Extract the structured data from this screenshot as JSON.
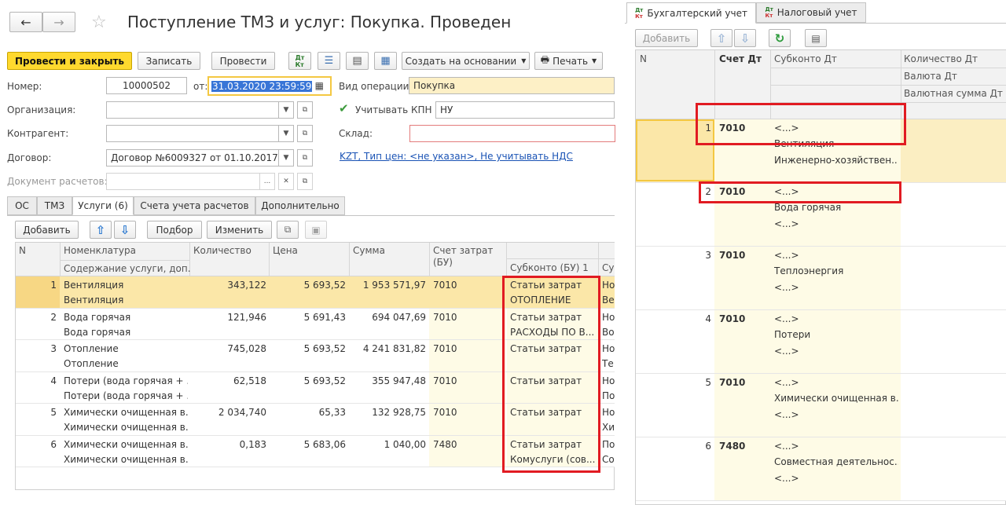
{
  "window": {
    "title": "Поступление ТМЗ и услуг: Покупка. Проведен"
  },
  "toolbar": {
    "post_close": "Провести и закрыть",
    "save": "Записать",
    "post": "Провести",
    "create_based": "Создать на основании",
    "print": "Печать"
  },
  "form": {
    "number_label": "Номер:",
    "number_value": "10000502",
    "date_label": "от:",
    "date_value": "31.03.2020 23:59:59",
    "operation_label": "Вид операции:",
    "operation_value": "Покупка",
    "org_label": "Организация:",
    "kpn_label": "Учитывать КПН",
    "kpn_value": "НУ",
    "counterparty_label": "Контрагент:",
    "warehouse_label": "Склад:",
    "contract_label": "Договор:",
    "contract_value": "Договор №6009327 от 01.10.2017г",
    "price_link": "KZT, Тип цен: <не указан>, Не учитывать НДС",
    "settlement_doc_label": "Документ расчетов:",
    "settlement_doc_dots": "..."
  },
  "tabs": [
    "ОС",
    "ТМЗ",
    "Услуги (6)",
    "Счета учета расчетов",
    "Дополнительно"
  ],
  "table_toolbar": {
    "add": "Добавить",
    "selection": "Подбор",
    "change": "Изменить"
  },
  "services_table": {
    "headers": {
      "n": "N",
      "nomenclature": "Номенклатура",
      "content": "Содержание услуги, доп.",
      "qty": "Количество",
      "price": "Цена",
      "sum": "Сумма",
      "account": "Счет затрат",
      "account2": "(БУ)",
      "subconto": "Субконто (БУ) 1",
      "next": "Су"
    },
    "rows": [
      {
        "n": "1",
        "name": "Вентиляция",
        "content": "Вентиляция",
        "qty": "343,122",
        "price": "5 693,52",
        "sum": "1 953 571,97",
        "account": "7010",
        "sub1": "Статьи затрат",
        "sub2": "ОТОПЛЕНИЕ",
        "c1": "Но",
        "c2": "Ве"
      },
      {
        "n": "2",
        "name": "Вода горячая",
        "content": "Вода горячая",
        "qty": "121,946",
        "price": "5 691,43",
        "sum": "694 047,69",
        "account": "7010",
        "sub1": "Статьи затрат",
        "sub2": "РАСХОДЫ ПО В...",
        "c1": "Но",
        "c2": "Во"
      },
      {
        "n": "3",
        "name": "Отопление",
        "content": "Отопление",
        "qty": "745,028",
        "price": "5 693,52",
        "sum": "4 241 831,82",
        "account": "7010",
        "sub1": "Статьи затрат",
        "sub2": "",
        "c1": "Но",
        "c2": "Те"
      },
      {
        "n": "4",
        "name": "Потери (вода горячая + ...",
        "content": "Потери (вода горячая + ...",
        "qty": "62,518",
        "price": "5 693,52",
        "sum": "355 947,48",
        "account": "7010",
        "sub1": "Статьи затрат",
        "sub2": "",
        "c1": "Но",
        "c2": "По"
      },
      {
        "n": "5",
        "name": "Химически очищенная в...",
        "content": "Химически очищенная в...",
        "qty": "2 034,740",
        "price": "65,33",
        "sum": "132 928,75",
        "account": "7010",
        "sub1": "Статьи затрат",
        "sub2": "",
        "c1": "Но",
        "c2": "Хи"
      },
      {
        "n": "6",
        "name": "Химически очищенная в...",
        "content": "Химически очищенная в...",
        "qty": "0,183",
        "price": "5 683,06",
        "sum": "1 040,00",
        "account": "7480",
        "sub1": "Статьи затрат",
        "sub2": "Комуслуги (сов...",
        "c1": "По",
        "c2": "Со"
      }
    ]
  },
  "right_tabs": [
    "Бухгалтерский учет",
    "Налоговый учет"
  ],
  "right_toolbar": {
    "add": "Добавить"
  },
  "accounting_table": {
    "headers": {
      "n": "N",
      "account_dt": "Счет Дт",
      "subconto_dt": "Субконто Дт",
      "qty_dt": "Количество Дт",
      "currency_dt": "Валюта Дт",
      "currency_sum_dt": "Валютная сумма Дт"
    },
    "rows": [
      {
        "n": "1",
        "account": "7010",
        "s1": "<...>",
        "s2": "Вентиляция",
        "s3": "Инженерно-хозяйствен..."
      },
      {
        "n": "2",
        "account": "7010",
        "s1": "<...>",
        "s2": "Вода горячая",
        "s3": "<...>"
      },
      {
        "n": "3",
        "account": "7010",
        "s1": "<...>",
        "s2": "Теплоэнергия",
        "s3": "<...>"
      },
      {
        "n": "4",
        "account": "7010",
        "s1": "<...>",
        "s2": "Потери",
        "s3": "<...>"
      },
      {
        "n": "5",
        "account": "7010",
        "s1": "<...>",
        "s2": "Химически очищенная в...",
        "s3": "<...>"
      },
      {
        "n": "6",
        "account": "7480",
        "s1": "<...>",
        "s2": "Совместная деятельнос...",
        "s3": "<...>"
      }
    ]
  },
  "colors": {
    "accent_yellow": "#ffd92e",
    "selected_row": "#fbe7a8",
    "highlight_border": "#e11b22",
    "link": "#1a53b5"
  }
}
